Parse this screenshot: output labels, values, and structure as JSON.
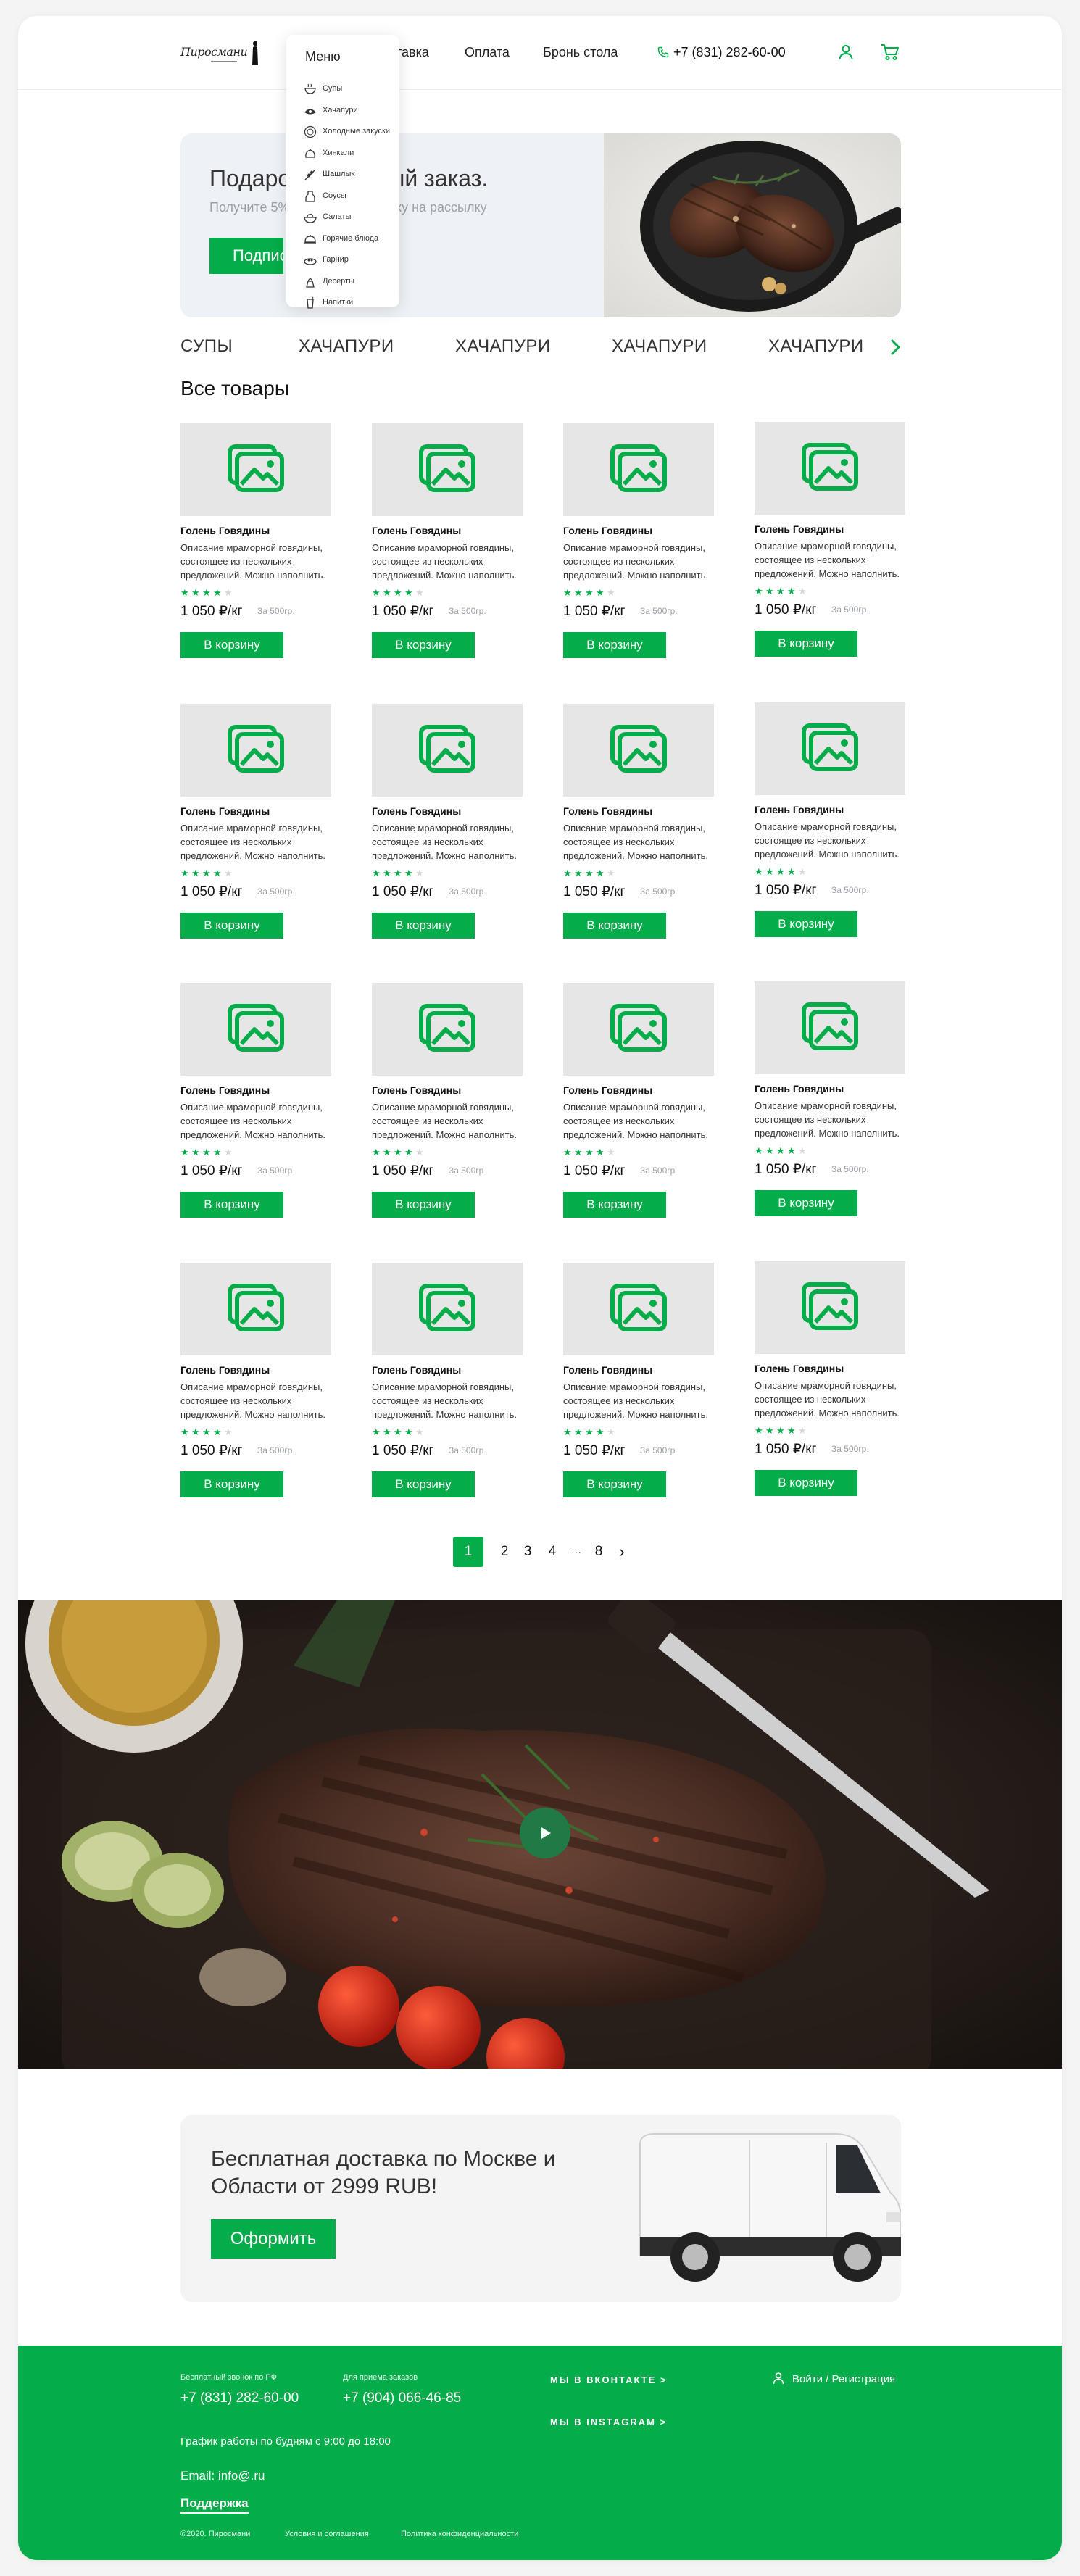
{
  "header": {
    "logo_text": "Пиросмани",
    "nav": {
      "delivery": "ставка",
      "payment": "Оплата",
      "booking": "Бронь стола"
    },
    "phone": "+7 (831) 282-60-00"
  },
  "menu": {
    "title": "Меню",
    "items": [
      {
        "label": "Супы",
        "icon": "soup-bowl-icon"
      },
      {
        "label": "Хачапури",
        "icon": "khachapuri-icon"
      },
      {
        "label": "Холодные закуски",
        "icon": "snack-plate-icon"
      },
      {
        "label": "Хинкали",
        "icon": "khinkali-icon"
      },
      {
        "label": "Шашлык",
        "icon": "skewer-icon"
      },
      {
        "label": "Соусы",
        "icon": "sauce-icon"
      },
      {
        "label": "Салаты",
        "icon": "salad-bowl-icon"
      },
      {
        "label": "Горячие блюда",
        "icon": "cloche-icon"
      },
      {
        "label": "Гарнир",
        "icon": "side-dish-icon"
      },
      {
        "label": "Десерты",
        "icon": "dessert-icon"
      },
      {
        "label": "Напитки",
        "icon": "drink-icon"
      }
    ]
  },
  "promo": {
    "title": "Подарок за первый заказ.",
    "subtitle": "Получите 5% скидку за подписку на рассылку",
    "button": "Подписаться"
  },
  "categories": [
    "СУПЫ",
    "ХАЧАПУРИ",
    "ХАЧАПУРИ",
    "ХАЧАПУРИ",
    "ХАЧАПУРИ"
  ],
  "section_title": "Все товары",
  "product": {
    "name": "Голень Говядины",
    "description": "Описание мраморной говядины, состоящее из нескольких предложений. Можно наполнить.",
    "rating": 4,
    "rating_max": 5,
    "price": "1 050 ₽/кг",
    "weight": "За 500гр.",
    "button": "В корзину"
  },
  "product_rows": 4,
  "product_cols": 4,
  "pagination": {
    "current": "1",
    "pages": [
      "2",
      "3",
      "4"
    ],
    "ellipsis": "···",
    "last": "8",
    "next": "›"
  },
  "delivery": {
    "title": "Бесплатная доставка по Москве и Области от 2999 RUB!",
    "button": "Оформить"
  },
  "footer": {
    "free_call_label": "Бесплатный звонок по РФ",
    "free_call_phone": "+7 (831) 282-60-00",
    "orders_label": "Для приема заказов",
    "orders_phone": "+7 (904) 066-46-85",
    "hours": "График работы по будням с 9:00 до 18:00",
    "email": "Email: info@.ru",
    "support": "Поддержка",
    "copyright": "©2020. Пиросмани",
    "terms": "Условия и соглашения",
    "privacy": "Политика конфиденциальности",
    "vk": "МЫ В ВКОНТАКТЕ >",
    "instagram": "МЫ В INSTAGRAM >",
    "login": "Войти / Регистрация"
  },
  "colors": {
    "accent": "#04ac4a",
    "star_empty": "#d6d6d6",
    "placeholder": "#e6e6e6"
  }
}
